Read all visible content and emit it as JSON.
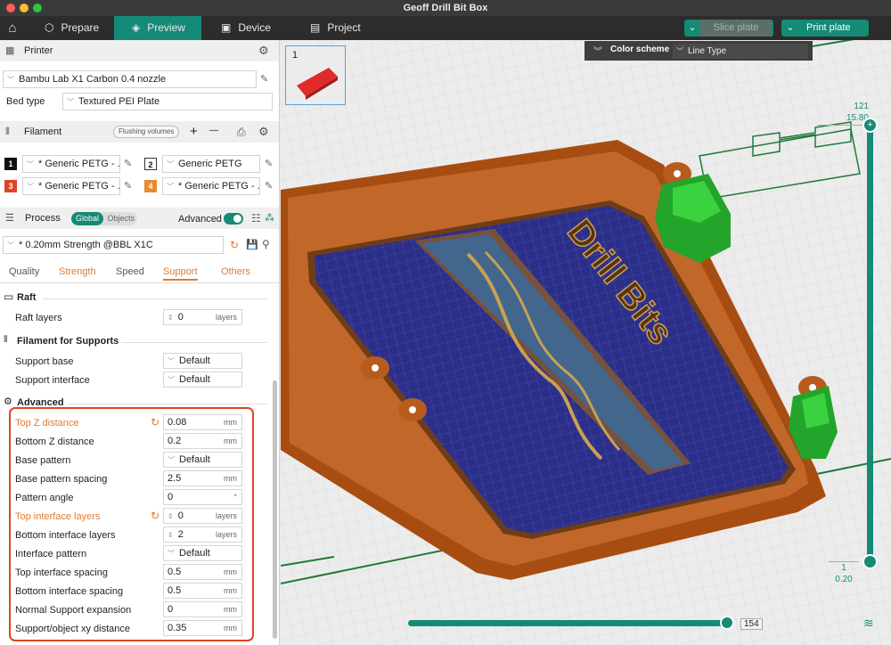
{
  "window": {
    "title": "Geoff Drill Bit Box"
  },
  "menu": {
    "home_icon": "home-icon",
    "tabs": [
      {
        "label": "Prepare",
        "icon": "cube-icon"
      },
      {
        "label": "Preview",
        "icon": "layers-icon"
      },
      {
        "label": "Device",
        "icon": "device-icon"
      },
      {
        "label": "Project",
        "icon": "project-icon"
      }
    ],
    "slice_plate": "Slice plate",
    "print_plate": "Print plate"
  },
  "printer": {
    "header": "Printer",
    "name": "Bambu Lab X1 Carbon 0.4 nozzle",
    "bed_type_label": "Bed type",
    "bed_type": "Textured PEI Plate"
  },
  "filament": {
    "header": "Filament",
    "flushing": "Flushing volumes",
    "add": "+",
    "remove": "—",
    "slots": [
      {
        "num": "1",
        "name": "* Generic PETG - ...",
        "color": "#111111"
      },
      {
        "num": "2",
        "name": "Generic PETG",
        "color": "#ffffff"
      },
      {
        "num": "3",
        "name": "* Generic PETG - ...",
        "color": "#e0412a"
      },
      {
        "num": "4",
        "name": "* Generic PETG - ...",
        "color": "#e88a2e"
      }
    ]
  },
  "process": {
    "header": "Process",
    "global": "Global",
    "objects": "Objects",
    "advanced": "Advanced",
    "preset": "* 0.20mm Strength @BBL X1C",
    "tabs": [
      "Quality",
      "Strength",
      "Speed",
      "Support",
      "Others"
    ]
  },
  "support": {
    "raft_title": "Raft",
    "raft_layers": {
      "label": "Raft layers",
      "value": "0",
      "unit": "layers"
    },
    "filament_title": "Filament for Supports",
    "support_base": {
      "label": "Support base",
      "value": "Default"
    },
    "support_interface": {
      "label": "Support interface",
      "value": "Default"
    },
    "advanced_title": "Advanced",
    "rows": [
      {
        "label": "Top Z distance",
        "value": "0.08",
        "unit": "mm"
      },
      {
        "label": "Bottom Z distance",
        "value": "0.2",
        "unit": "mm"
      },
      {
        "label": "Base pattern",
        "value": "Default",
        "unit": ""
      },
      {
        "label": "Base pattern spacing",
        "value": "2.5",
        "unit": "mm"
      },
      {
        "label": "Pattern angle",
        "value": "0",
        "unit": "°"
      },
      {
        "label": "Top interface layers",
        "value": "0",
        "unit": "layers"
      },
      {
        "label": "Bottom interface layers",
        "value": "2",
        "unit": "layers"
      },
      {
        "label": "Interface pattern",
        "value": "Default",
        "unit": ""
      },
      {
        "label": "Top interface spacing",
        "value": "0.5",
        "unit": "mm"
      },
      {
        "label": "Bottom interface spacing",
        "value": "0.5",
        "unit": "mm"
      },
      {
        "label": "Normal Support expansion",
        "value": "0",
        "unit": "mm"
      },
      {
        "label": "Support/object xy distance",
        "value": "0.35",
        "unit": "mm"
      }
    ]
  },
  "preview": {
    "plate_number": "1",
    "color_scheme_label": "Color scheme",
    "color_scheme_value": "Line Type",
    "slider_top_layer": "121",
    "slider_top_height": "15.80",
    "slider_bottom_layer": "1",
    "slider_bottom_height": "0.20",
    "horizontal_value": "154",
    "model_text": "Drill Bits"
  },
  "colors": {
    "accent": "#158a76",
    "highlight": "#e2451f",
    "orange_text": "#e07a2f"
  }
}
